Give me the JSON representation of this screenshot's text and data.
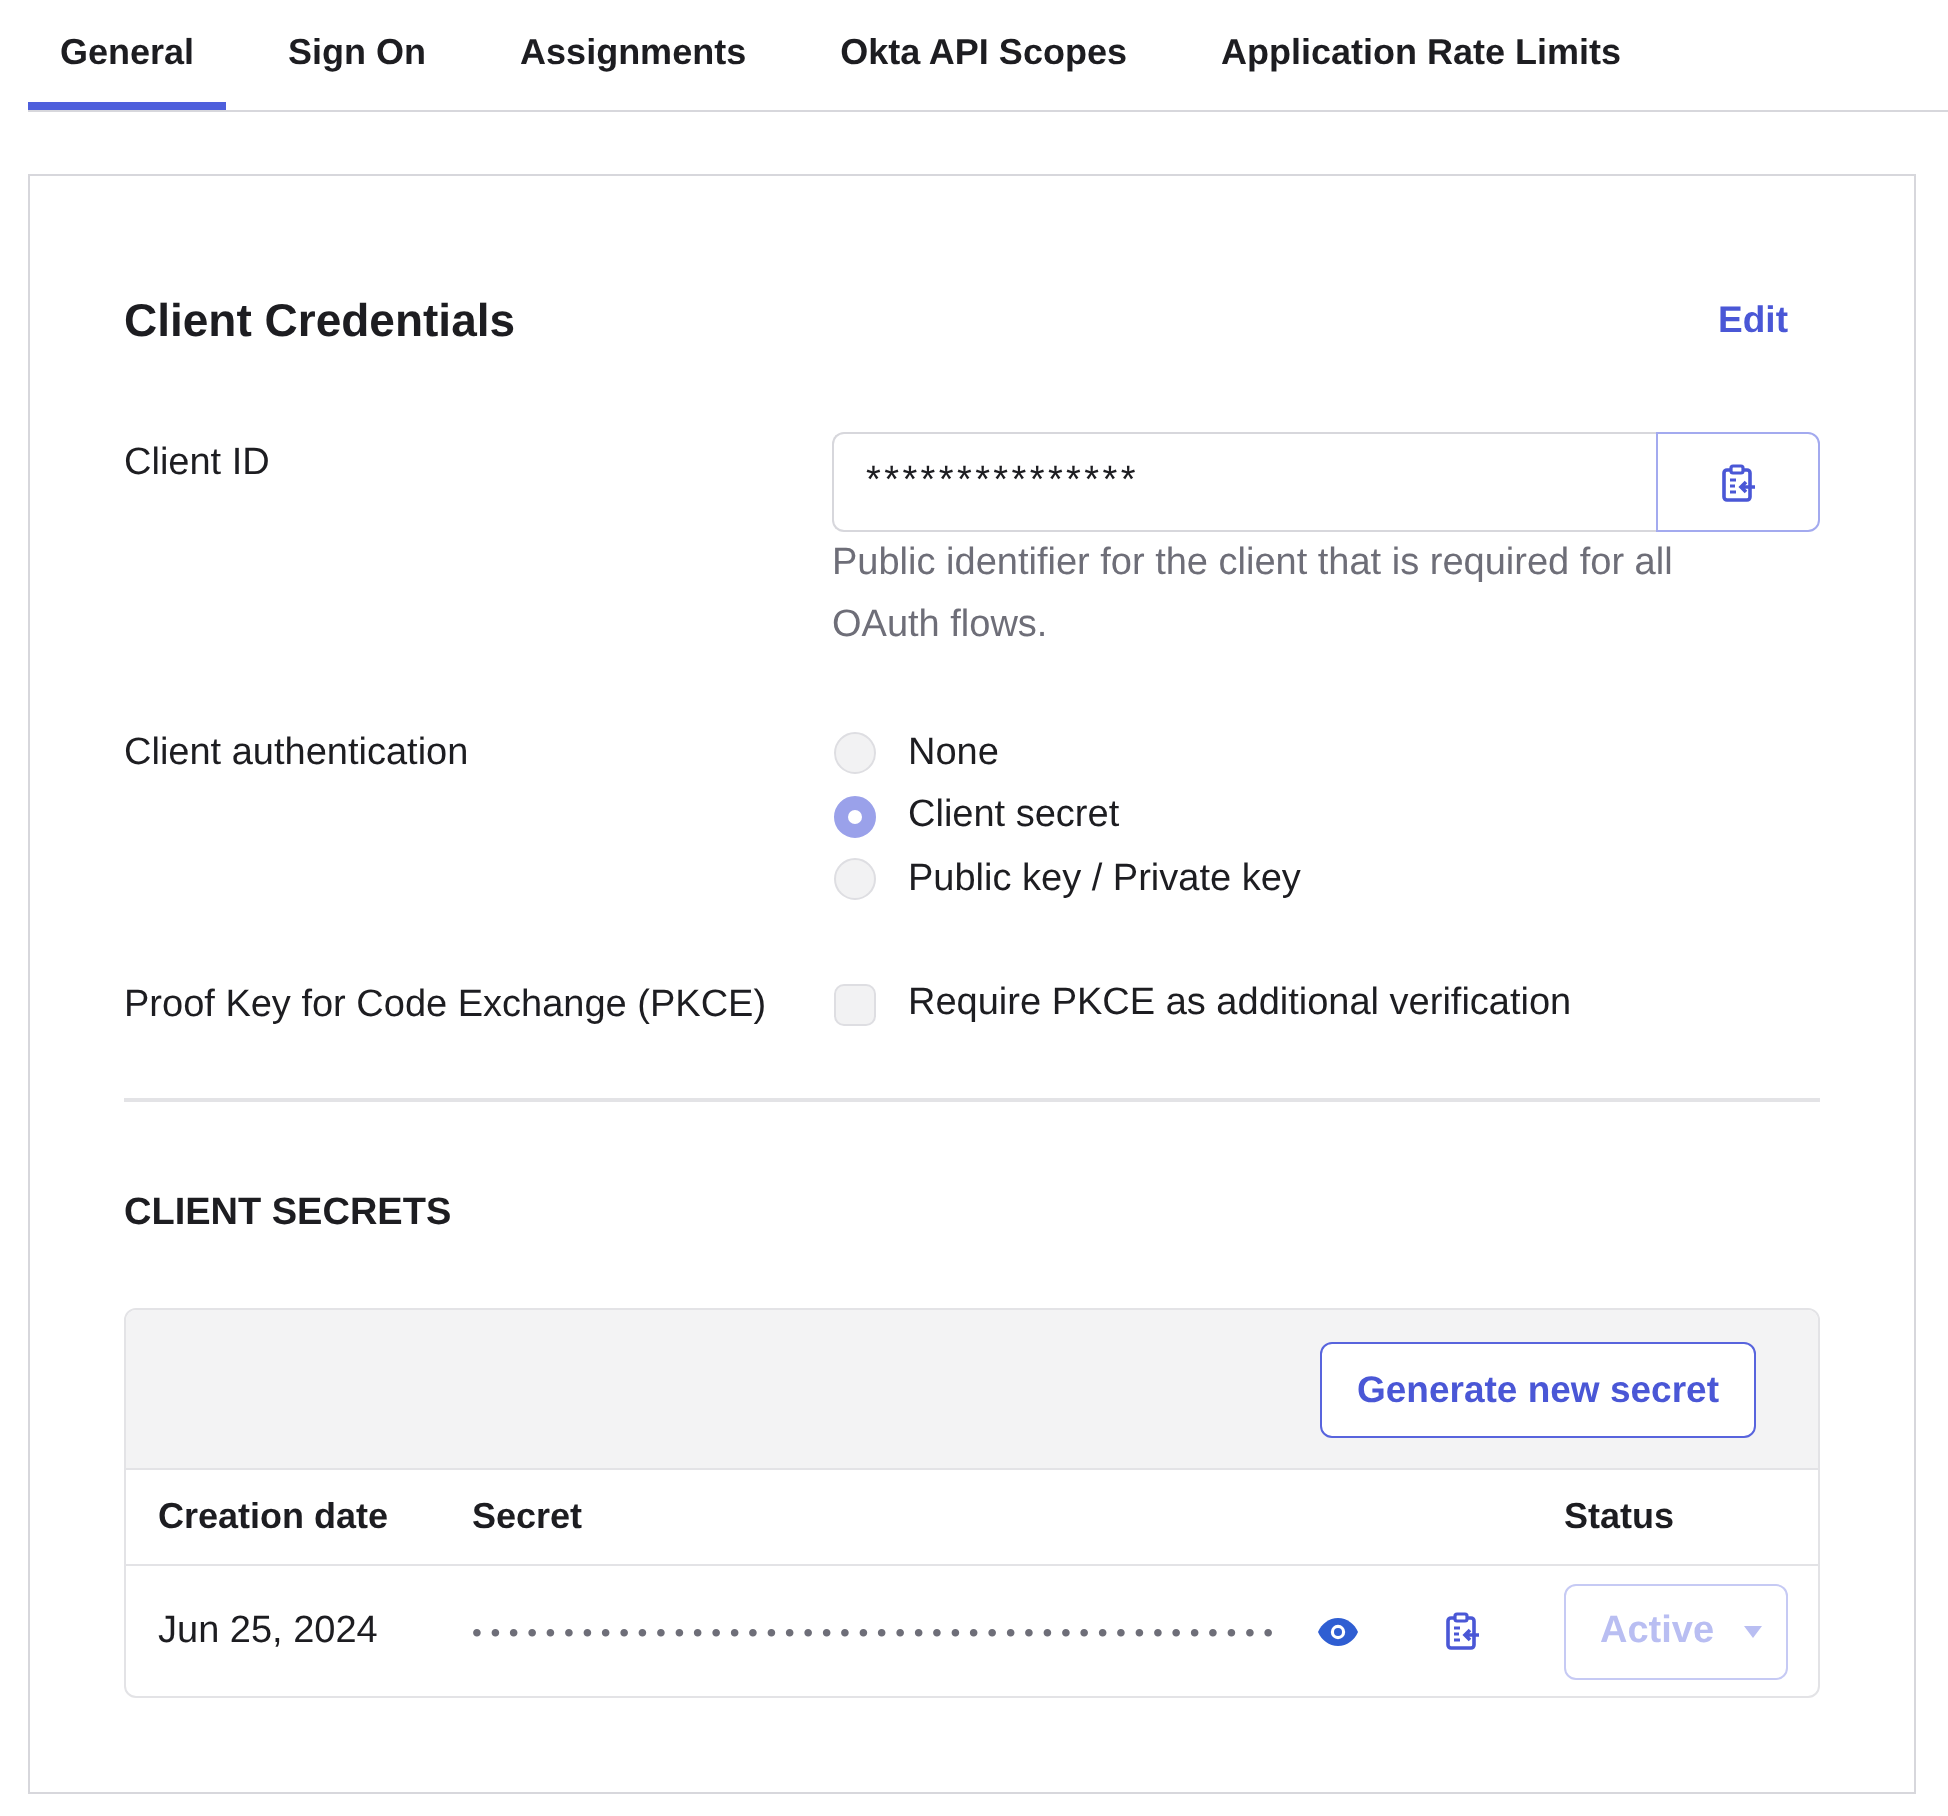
{
  "tabs": [
    {
      "label": "General",
      "selected": true
    },
    {
      "label": "Sign On",
      "selected": false
    },
    {
      "label": "Assignments",
      "selected": false
    },
    {
      "label": "Okta API Scopes",
      "selected": false
    },
    {
      "label": "Application Rate Limits",
      "selected": false
    }
  ],
  "section": {
    "title": "Client Credentials",
    "edit_link": "Edit"
  },
  "client_id": {
    "label": "Client ID",
    "value": "***************",
    "help": "Public identifier for the client that is required for all OAuth flows."
  },
  "client_authentication": {
    "label": "Client authentication",
    "options": [
      {
        "label": "None",
        "selected": false
      },
      {
        "label": "Client secret",
        "selected": true
      },
      {
        "label": "Public key / Private key",
        "selected": false
      }
    ]
  },
  "pkce": {
    "label": "Proof Key for Code Exchange (PKCE)",
    "option": "Require PKCE as additional verification",
    "checked": false
  },
  "client_secrets": {
    "heading": "CLIENT SECRETS",
    "generate_button": "Generate new secret",
    "columns": [
      "Creation date",
      "Secret",
      "Status"
    ],
    "rows": [
      {
        "creation_date": "Jun 25, 2024",
        "secret": "••••••••••••••••••••••••••••••••••••••••••••",
        "status": "Active",
        "status_disabled": true
      }
    ]
  }
}
